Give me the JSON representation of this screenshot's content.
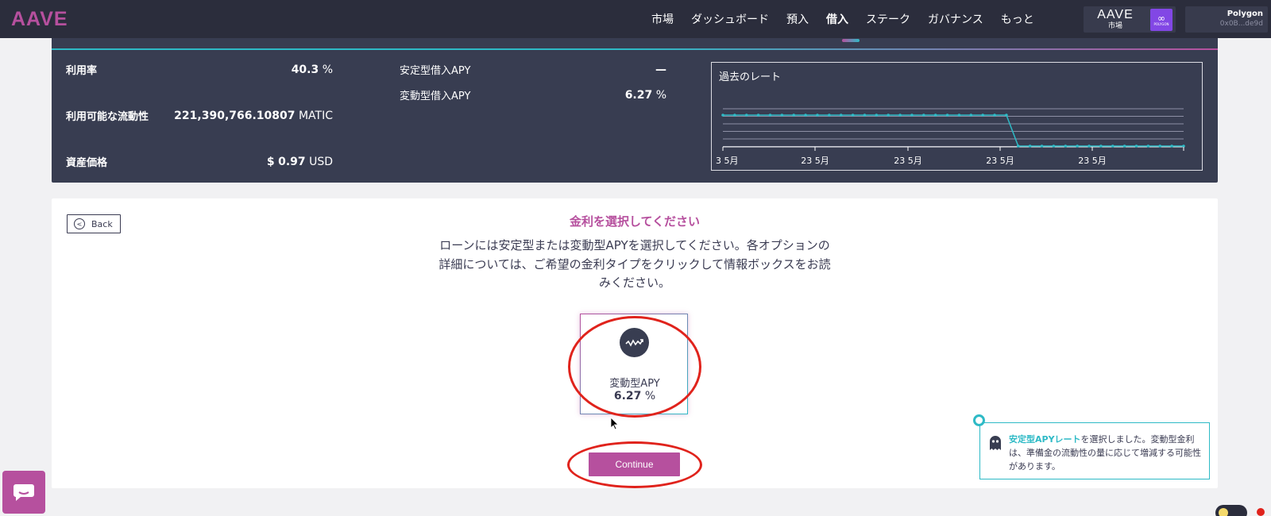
{
  "nav": {
    "logo": "AAVE",
    "items": [
      {
        "label": "市場",
        "active": false
      },
      {
        "label": "ダッシュボード",
        "active": false
      },
      {
        "label": "預入",
        "active": false
      },
      {
        "label": "借入",
        "active": true
      },
      {
        "label": "ステーク",
        "active": false
      },
      {
        "label": "ガバナンス",
        "active": false
      },
      {
        "label": "もっと",
        "active": false
      }
    ],
    "market": {
      "brand": "AAVE",
      "label": "市場",
      "network_badge": "POLYGON"
    },
    "wallet": {
      "network": "Polygon",
      "address": "0x0B...de9d"
    }
  },
  "stats": {
    "utilization": {
      "label": "利用率",
      "value": "40.3",
      "unit": "%"
    },
    "available": {
      "label": "利用可能な流動性",
      "value": "221,390,766.10807",
      "unit": "MATIC"
    },
    "price": {
      "label": "資産価格",
      "prefix": "$",
      "value": "0.97",
      "unit": "USD"
    },
    "stable_apy": {
      "label": "安定型借入APY",
      "value": "—"
    },
    "variable_apy": {
      "label": "変動型借入APY",
      "value": "6.27",
      "unit": "%"
    }
  },
  "history": {
    "title": "過去のレート",
    "chart_data": {
      "type": "line",
      "xlabel": "",
      "ylabel": "",
      "x_ticks": [
        "3 5月",
        "23 5月",
        "23 5月",
        "23 5月",
        "23 5月"
      ],
      "series": [
        {
          "values": [
            1.0,
            1.0,
            1.0,
            1.0,
            1.0,
            1.0,
            1.0,
            1.0,
            1.0,
            1.0,
            1.0,
            1.0,
            1.0,
            1.0,
            1.0,
            1.0,
            1.0,
            1.0,
            1.0,
            1.0,
            1.0,
            1.0,
            1.0,
            1.0,
            1.0,
            0.0,
            0.0,
            0.0,
            0.0,
            0.0,
            0.0,
            0.0,
            0.0,
            0.0,
            0.0,
            0.0,
            0.0,
            0.0,
            0.0,
            0.0
          ]
        }
      ],
      "grid": true,
      "color": "#2ebac6"
    }
  },
  "card": {
    "back_label": "Back",
    "title": "金利を選択してください",
    "description": "ローンには安定型または変動型APYを選択してください。各オプションの詳細については、ご希望の金利タイプをクリックして情報ボックスをお読みください。",
    "option": {
      "label": "変動型APY",
      "value": "6.27",
      "unit": "%",
      "icon": "variable-rate-icon"
    },
    "continue_label": "Continue",
    "info": {
      "highlight": "安定型APYレート",
      "text": "を選択しました。変動型金利は、準備金の流動性の量に応じて増減する可能性があります。"
    }
  },
  "colors": {
    "brand_pink": "#b6509e",
    "brand_teal": "#2ebac6",
    "nav_bg": "#2b2d3c",
    "panel_bg": "#383d51",
    "annotation_red": "#e0231c"
  }
}
